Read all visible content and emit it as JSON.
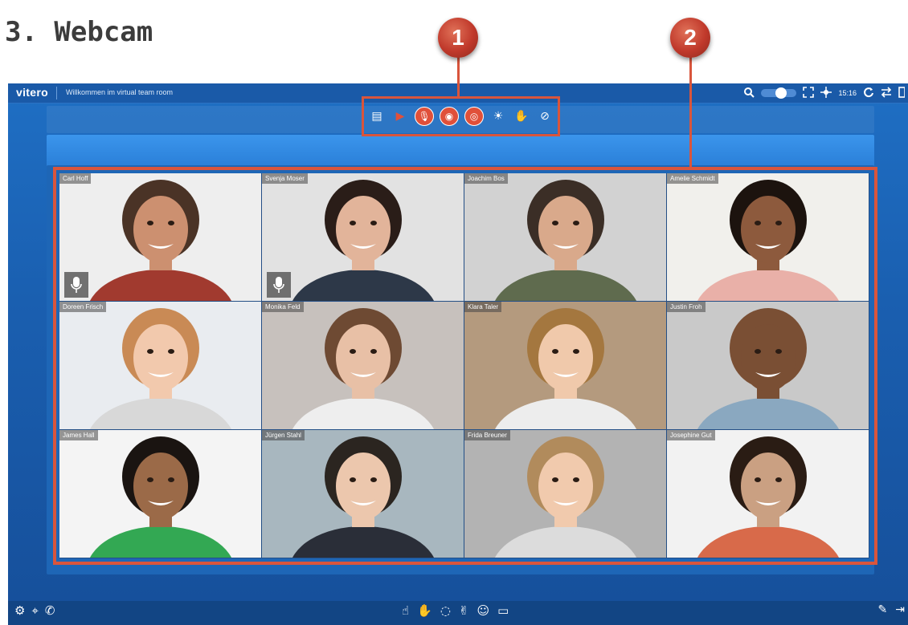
{
  "heading": "3. Webcam",
  "app": {
    "logo": "vitero",
    "room_title": "Willkommen im virtual team room",
    "time": "15:16",
    "icons": {
      "search": "search-icon",
      "toggle": "toggle-switch",
      "fullscreen": "fullscreen-icon",
      "network": "network-icon",
      "reload": "reload-icon",
      "switch": "switch-icon"
    }
  },
  "markers": [
    "1",
    "2"
  ],
  "toolbar": {
    "items": [
      {
        "name": "presentation-icon",
        "glyph": "▤",
        "style": "plain"
      },
      {
        "name": "pointer-icon",
        "glyph": "▶",
        "style": "plain-red"
      },
      {
        "name": "microphone-icon",
        "glyph": "🎙",
        "style": "red"
      },
      {
        "name": "webcam-all-icon",
        "glyph": "◉",
        "style": "red"
      },
      {
        "name": "webcam-icon",
        "glyph": "◎",
        "style": "red"
      },
      {
        "name": "brightness-icon",
        "glyph": "☀",
        "style": "plain"
      },
      {
        "name": "hand-raise-icon",
        "glyph": "✋",
        "style": "plain"
      },
      {
        "name": "no-chat-icon",
        "glyph": "⊘",
        "style": "plain"
      }
    ]
  },
  "participants": [
    {
      "name": "Carl Hoff",
      "mic": true,
      "bg": "#eeeeee",
      "skin": "#cc9070",
      "hair": "#4a3326",
      "shirt": "#a13a2f"
    },
    {
      "name": "Svenja Moser",
      "mic": true,
      "bg": "#e2e2e2",
      "skin": "#e2b49a",
      "hair": "#2a1d18",
      "shirt": "#2d3848"
    },
    {
      "name": "Joachim Bos",
      "mic": false,
      "bg": "#d2d2d2",
      "skin": "#d9a98b",
      "hair": "#3b2e26",
      "shirt": "#5f6b4e"
    },
    {
      "name": "Amelie Schmidt",
      "mic": false,
      "bg": "#f1f0ec",
      "skin": "#8d5a3d",
      "hair": "#1c130e",
      "shirt": "#e9b0a8"
    },
    {
      "name": "Doreen Frisch",
      "mic": false,
      "bg": "#e9ecf0",
      "skin": "#f2c9ad",
      "hair": "#c98a55",
      "shirt": "#d8d8d8"
    },
    {
      "name": "Monika Feld",
      "mic": false,
      "bg": "#c7c1bd",
      "skin": "#e8c0a6",
      "hair": "#6e4a33",
      "shirt": "#eeeeee"
    },
    {
      "name": "Klara Taler",
      "mic": false,
      "bg": "#b49a7e",
      "skin": "#f0c9ab",
      "hair": "#a4773f",
      "shirt": "#ededed"
    },
    {
      "name": "Justin Froh",
      "mic": false,
      "bg": "#c9c9c9",
      "skin": "#7a4f34",
      "hair": "#7a4f34",
      "shirt": "#8aa8c0"
    },
    {
      "name": "James Hall",
      "mic": false,
      "bg": "#f4f4f4",
      "skin": "#9b6a48",
      "hair": "#1a1411",
      "shirt": "#33a853"
    },
    {
      "name": "Jürgen Stahl",
      "mic": false,
      "bg": "#a8b7bf",
      "skin": "#ecc7ad",
      "hair": "#2b2520",
      "shirt": "#2a2e38"
    },
    {
      "name": "Frida Breuner",
      "mic": false,
      "bg": "#b3b3b3",
      "skin": "#f1caad",
      "hair": "#b18b5c",
      "shirt": "#dcdcdc"
    },
    {
      "name": "Josephine Gut",
      "mic": false,
      "bg": "#f2f2f2",
      "skin": "#caa082",
      "hair": "#2a1c14",
      "shirt": "#d86a4a"
    }
  ],
  "bottom": {
    "left": [
      {
        "name": "settings-icon",
        "glyph": "⚙"
      },
      {
        "name": "video-settings-icon",
        "glyph": "⌖"
      },
      {
        "name": "phone-icon",
        "glyph": "✆"
      }
    ],
    "center": [
      {
        "name": "hand-point-icon",
        "glyph": "☝"
      },
      {
        "name": "hand-raise-icon",
        "glyph": "✋"
      },
      {
        "name": "speech-question-icon",
        "glyph": "◌"
      },
      {
        "name": "applause-icon",
        "glyph": "✌"
      },
      {
        "name": "smiley-icon",
        "glyph": "☺"
      },
      {
        "name": "chat-icon",
        "glyph": "▭"
      }
    ],
    "right": [
      {
        "name": "pen-off-icon",
        "glyph": "✎"
      },
      {
        "name": "exit-icon",
        "glyph": "⇥"
      }
    ]
  }
}
